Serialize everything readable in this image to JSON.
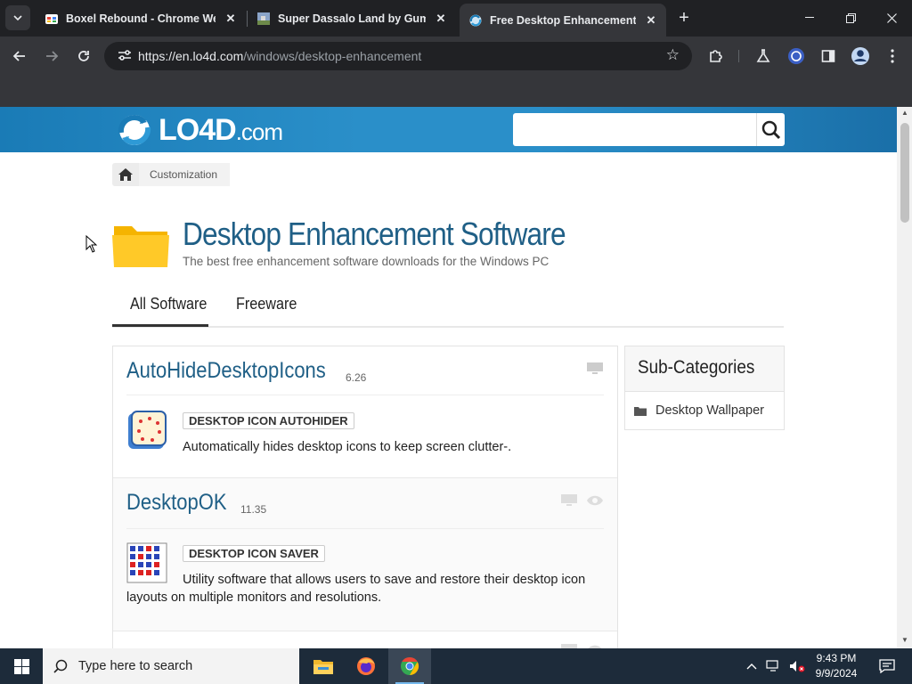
{
  "browser": {
    "tabs": [
      {
        "title": "Boxel Rebound - Chrome Web",
        "close": "✕"
      },
      {
        "title": "Super Dassalo Land by Gumpy",
        "close": "✕"
      },
      {
        "title": "Free Desktop Enhancement So",
        "close": "✕",
        "active": true
      }
    ],
    "new_tab": "+",
    "url_host": "https://en.lo4d.com",
    "url_path": "/windows/desktop-enhancement"
  },
  "site": {
    "logo_main": "LO4D",
    "logo_suffix": ".com",
    "search_placeholder": ""
  },
  "breadcrumb": {
    "home_icon": "home-icon",
    "item": "Customization"
  },
  "page": {
    "title": "Desktop Enhancement Software",
    "subtitle": "The best free enhancement software downloads for the Windows PC",
    "tabs": [
      "All Software",
      "Freeware"
    ]
  },
  "software": [
    {
      "name": "AutoHideDesktopIcons",
      "version": "6.26",
      "tag": "DESKTOP ICON AUTOHIDER",
      "description": "Automatically hides desktop icons to keep screen clutter-."
    },
    {
      "name": "DesktopOK",
      "version": "11.35",
      "tag": "DESKTOP ICON SAVER",
      "description": "Utility software that allows users to save and restore their desktop icon layouts on multiple monitors and resolutions."
    }
  ],
  "sidebar": {
    "heading": "Sub-Categories",
    "links": [
      "Desktop Wallpaper"
    ]
  },
  "taskbar": {
    "search_placeholder": "Type here to search",
    "time": "9:43 PM",
    "date": "9/9/2024"
  },
  "colors": {
    "header_blue": "#2a8fc9",
    "title_blue": "#1f5f86",
    "taskbar": "#1d2b3a"
  }
}
